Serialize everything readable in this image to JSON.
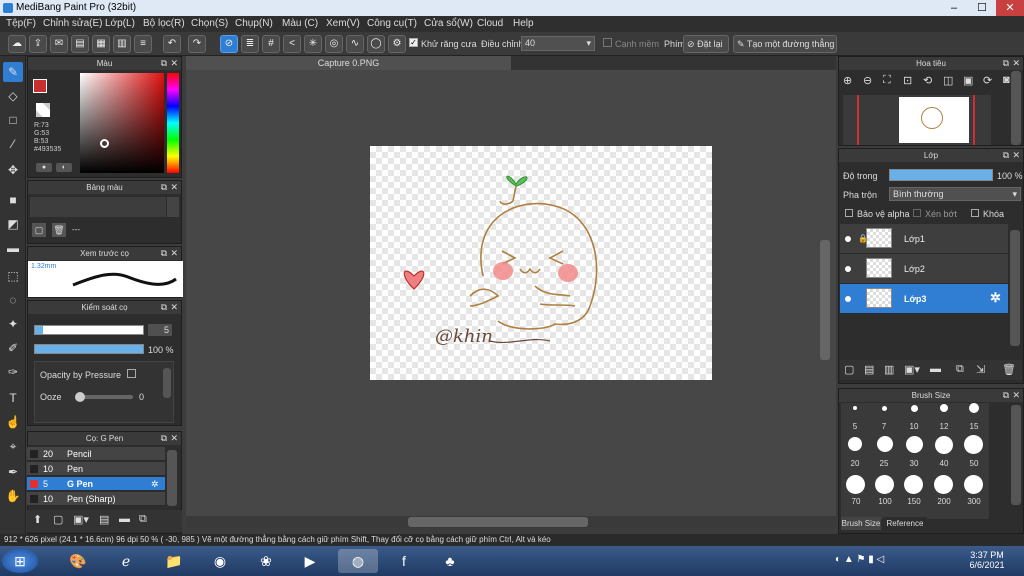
{
  "title": "MediBang Paint Pro (32bit)",
  "menu": [
    "Tệp(F)",
    "Chỉnh sửa(E)",
    "Lớp(L)",
    "Bộ lọc(R)",
    "Chọn(S)",
    "Chụp(N)",
    "Màu (C)",
    "Xem(V)",
    "Công cụ(T)",
    "Cửa sổ(W)",
    "Cloud",
    "Help"
  ],
  "toolbar": {
    "antialias": "Khử răng cưa",
    "adjust": "Điều chỉnh",
    "adjust_value": "40",
    "snap": "Cạnh mềm",
    "pen_label": "Phím",
    "reset": "Đặt lại",
    "make_line": "Tạo một đường thẳng"
  },
  "color_panel": {
    "title": "Màu",
    "r": "R:73",
    "g": "G:53",
    "b": "B:53",
    "hex": "#493535"
  },
  "palette_panel": {
    "title": "Bảng màu",
    "dash": "---"
  },
  "brush_preview": {
    "title": "Xem trước cọ",
    "size": "1.32mm"
  },
  "brush_control": {
    "title": "Kiểm soát cọ",
    "size": "5",
    "opacity": "100 %",
    "opacity_pressure": "Opacity by Pressure",
    "ooze": "Ooze",
    "ooze_val": "0"
  },
  "brush_list": {
    "title": "Cọ: G Pen",
    "items": [
      {
        "size": "20",
        "name": "Pencil"
      },
      {
        "size": "10",
        "name": "Pen"
      },
      {
        "size": "5",
        "name": "G Pen"
      },
      {
        "size": "10",
        "name": "Pen (Sharp)"
      }
    ]
  },
  "canvas_tab": "Capture 0.PNG",
  "navigator": {
    "title": "Hoa tiêu"
  },
  "layer_panel": {
    "title": "Lớp",
    "opacity_label": "Độ trong",
    "opacity_value": "100 %",
    "blend_label": "Pha trộn",
    "blend_value": "Bình thường",
    "protect_alpha": "Bảo vệ alpha",
    "clip": "Xén bớt",
    "lock": "Khóa",
    "layers": [
      "Lớp1",
      "Lớp2",
      "Lớp3"
    ]
  },
  "brush_size": {
    "title": "Brush Size",
    "row1": [
      "5",
      "7",
      "10",
      "12",
      "15"
    ],
    "row2": [
      "20",
      "25",
      "30",
      "40",
      "50"
    ],
    "row3": [
      "70",
      "100",
      "150",
      "200",
      "300"
    ],
    "tab1": "Brush Size",
    "tab2": "Reference"
  },
  "status": {
    "text": "912 * 626 pixel   (24.1 * 16.6cm)   96 dpi   50 %   ( -30, 985 )   Vẽ một đường thẳng bằng cách giữ phím Shift, Thay đổi cỡ cọ bằng cách giữ phím Ctrl, Alt và kéo"
  },
  "signature": "@khin",
  "clock": {
    "time": "3:37 PM",
    "date": "6/6/2021"
  }
}
